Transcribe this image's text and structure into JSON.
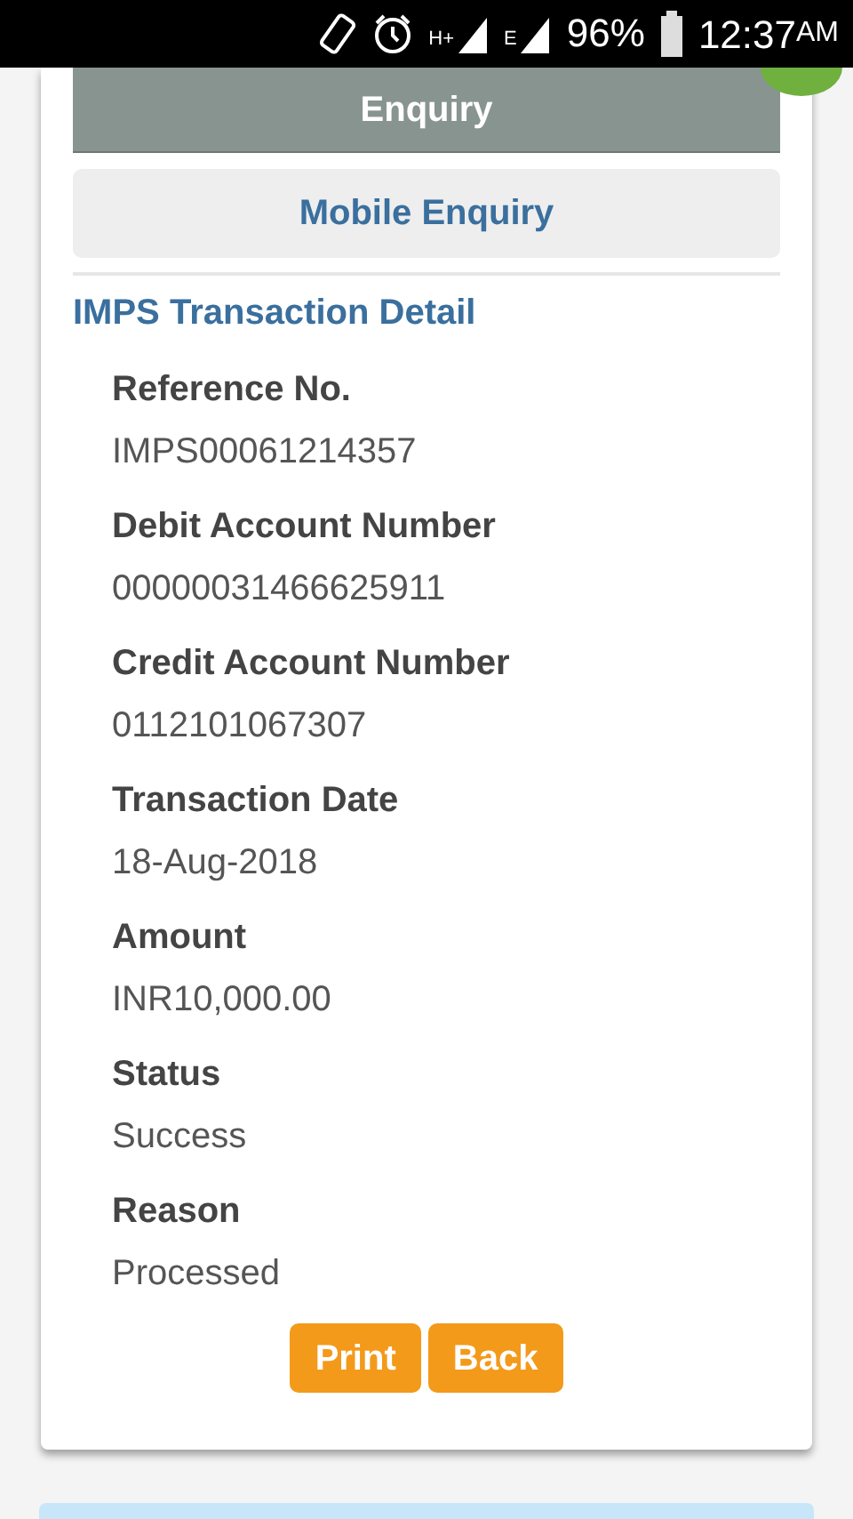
{
  "status_bar": {
    "network_1": "H+",
    "network_2": "E",
    "battery": "96%",
    "time": "12:37",
    "ampm": "AM"
  },
  "menu": [
    {
      "label": "Enquiry",
      "selected": true
    },
    {
      "label": "Mobile Enquiry",
      "selected": false
    }
  ],
  "section_title": "IMPS Transaction Detail",
  "fields": [
    {
      "label": "Reference No.",
      "value": "IMPS00061214357"
    },
    {
      "label": "Debit Account Number",
      "value": "00000031466625911"
    },
    {
      "label": "Credit Account Number",
      "value": "0112101067307"
    },
    {
      "label": "Transaction Date",
      "value": "18-Aug-2018"
    },
    {
      "label": "Amount",
      "value": "INR10,000.00"
    },
    {
      "label": "Status",
      "value": "Success"
    },
    {
      "label": "Reason",
      "value": "Processed"
    }
  ],
  "buttons": [
    "Print",
    "Back"
  ]
}
